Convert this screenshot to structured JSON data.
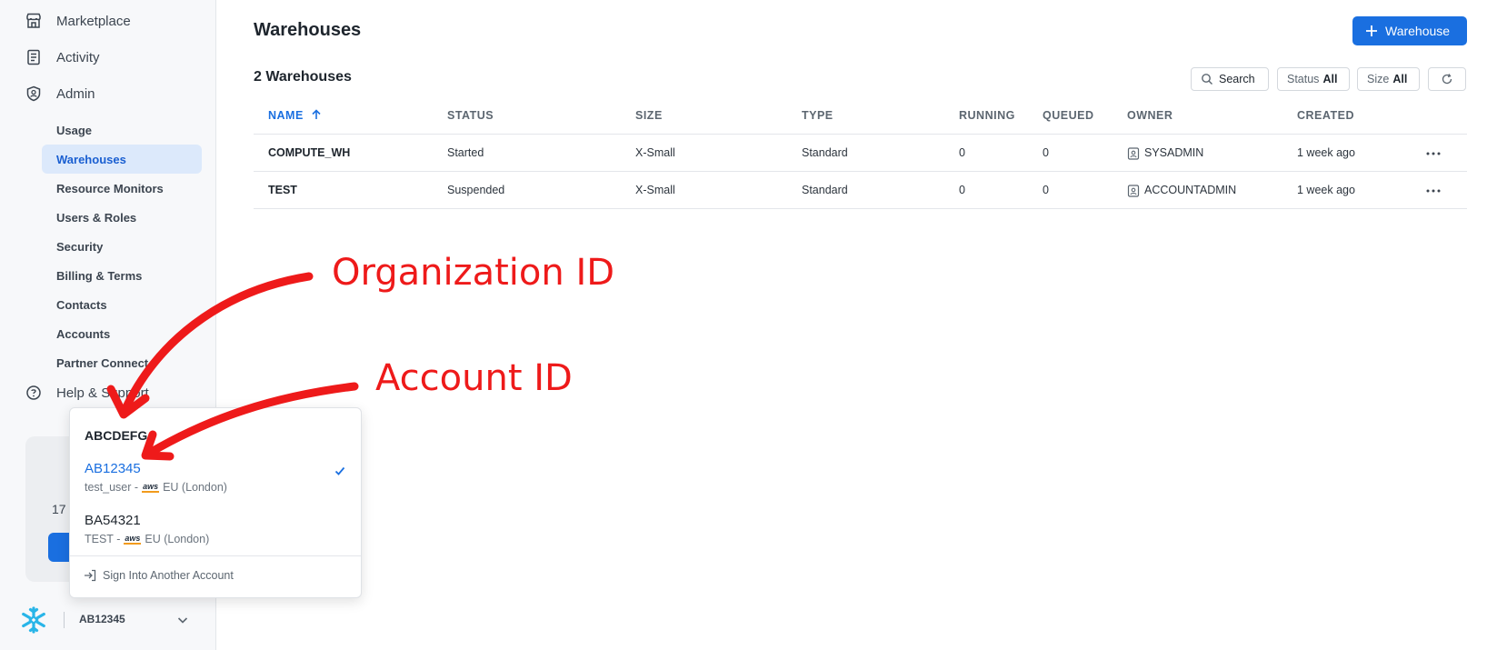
{
  "sidebar": {
    "top_items": [
      {
        "label": "Marketplace",
        "icon": "storefront-icon"
      },
      {
        "label": "Activity",
        "icon": "document-list-icon"
      },
      {
        "label": "Admin",
        "icon": "shield-icon"
      }
    ],
    "admin_items": [
      {
        "label": "Usage",
        "active": false
      },
      {
        "label": "Warehouses",
        "active": true
      },
      {
        "label": "Resource Monitors",
        "active": false
      },
      {
        "label": "Users & Roles",
        "active": false
      },
      {
        "label": "Security",
        "active": false
      },
      {
        "label": "Billing & Terms",
        "active": false
      },
      {
        "label": "Contacts",
        "active": false
      },
      {
        "label": "Accounts",
        "active": false
      },
      {
        "label": "Partner Connect",
        "active": false
      }
    ],
    "help": {
      "label": "Help & Support",
      "icon": "help-circle-icon"
    },
    "promo_text": "17",
    "account_label": "AB12345"
  },
  "header": {
    "title": "Warehouses",
    "add_button": "Warehouse"
  },
  "toolbar": {
    "count": "2 Warehouses",
    "search": "Search",
    "status_label": "Status",
    "status_value": "All",
    "size_label": "Size",
    "size_value": "All"
  },
  "table": {
    "columns": [
      "NAME",
      "STATUS",
      "SIZE",
      "TYPE",
      "RUNNING",
      "QUEUED",
      "OWNER",
      "CREATED"
    ],
    "rows": [
      {
        "name": "COMPUTE_WH",
        "status": "Started",
        "size": "X-Small",
        "type": "Standard",
        "running": "0",
        "queued": "0",
        "owner": "SYSADMIN",
        "created": "1 week ago"
      },
      {
        "name": "TEST",
        "status": "Suspended",
        "size": "X-Small",
        "type": "Standard",
        "running": "0",
        "queued": "0",
        "owner": "ACCOUNTADMIN",
        "created": "1 week ago"
      }
    ]
  },
  "annotations": {
    "org_label": "Organization ID",
    "account_label": "Account ID",
    "color": "#ee1a1a"
  },
  "popup": {
    "org_name": "ABCDEFG",
    "accounts": [
      {
        "id": "AB12345",
        "user": "test_user -",
        "region": "EU (London)",
        "selected": true
      },
      {
        "id": "BA54321",
        "user": "TEST -",
        "region": "EU (London)",
        "selected": false
      }
    ],
    "aws_text": "aws",
    "sign_in": "Sign Into Another Account"
  },
  "colors": {
    "accent": "#1a6fe0",
    "active_bg": "#dce9fb",
    "snowflake": "#29b5e8"
  }
}
